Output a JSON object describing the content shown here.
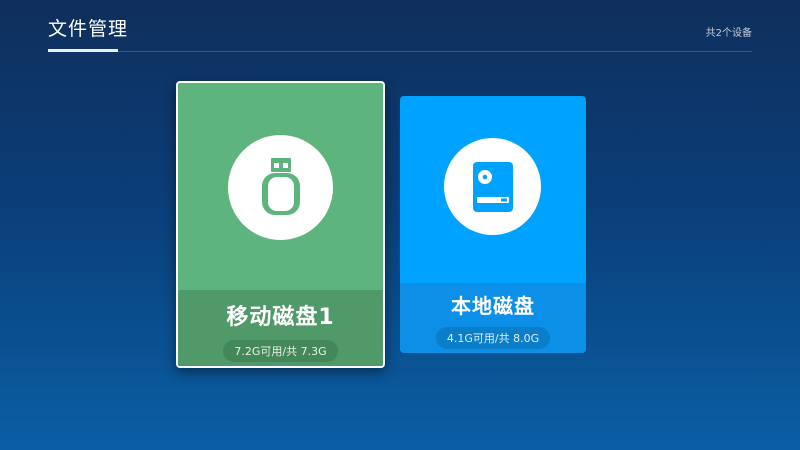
{
  "header": {
    "title": "文件管理",
    "device_count": "共2个设备"
  },
  "devices": [
    {
      "name": "移动磁盘1",
      "capacity": "7.2G可用/共 7.3G",
      "icon": "usb-drive-icon",
      "color": "#5db47d",
      "focused": true
    },
    {
      "name": "本地磁盘",
      "capacity": "4.1G可用/共 8.0G",
      "icon": "hard-disk-icon",
      "color": "#00a2ff",
      "focused": false
    }
  ]
}
